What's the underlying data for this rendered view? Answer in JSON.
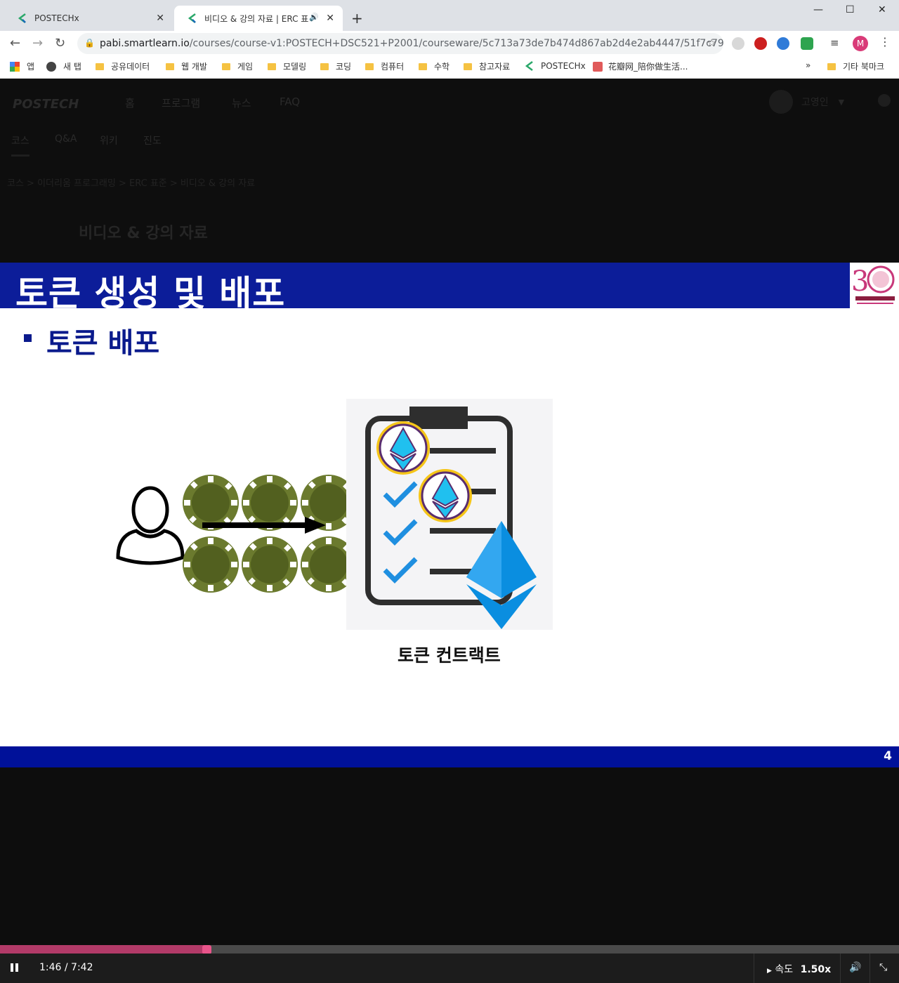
{
  "browser": {
    "tabs": [
      {
        "title": "POSTECHx",
        "active": false
      },
      {
        "title": "비디오 & 강의 자료 | ERC 표",
        "active": true
      }
    ],
    "url_host": "pabi.smartlearn.io",
    "url_path": "/courses/course-v1:POSTECH+DSC521+P2001/courseware/5c713a73de7b474d867ab2d4e2ab4447/51f7c794931149f...",
    "profile_initial": "M",
    "bookmarks": [
      "앱",
      "새 탭",
      "공유데이터",
      "웹 개발",
      "게임",
      "모델링",
      "코딩",
      "컴퓨터",
      "수학",
      "참고자료",
      "POSTECHx",
      "花瓣网_陪你做生活...",
      "»",
      "기타 북마크"
    ]
  },
  "site": {
    "logo": "POSTECH",
    "nav": [
      "홈",
      "프로그램",
      "뉴스",
      "FAQ"
    ],
    "username": "고영인",
    "subnav": [
      "코스",
      "Q&A",
      "위키",
      "진도"
    ],
    "breadcrumb": "코스 > 이더리움 프로그래밍 > ERC 표준 > 비디오 & 강의 자료",
    "heading": "비디오 & 강의 자료"
  },
  "slide": {
    "title": "토큰 생성 및 배포",
    "bullet": "토큰 배포",
    "caption": "토큰 컨트랙트",
    "page_number": "4",
    "header_color": "#0c1d99",
    "chip_color": "#6b7a2e",
    "eth_color": "#0a8ee0"
  },
  "player": {
    "time": "1:46 / 7:42",
    "progress": 0.23,
    "speed_label": "속도",
    "speed_value": "1.50x",
    "accent": "#b23a68"
  }
}
